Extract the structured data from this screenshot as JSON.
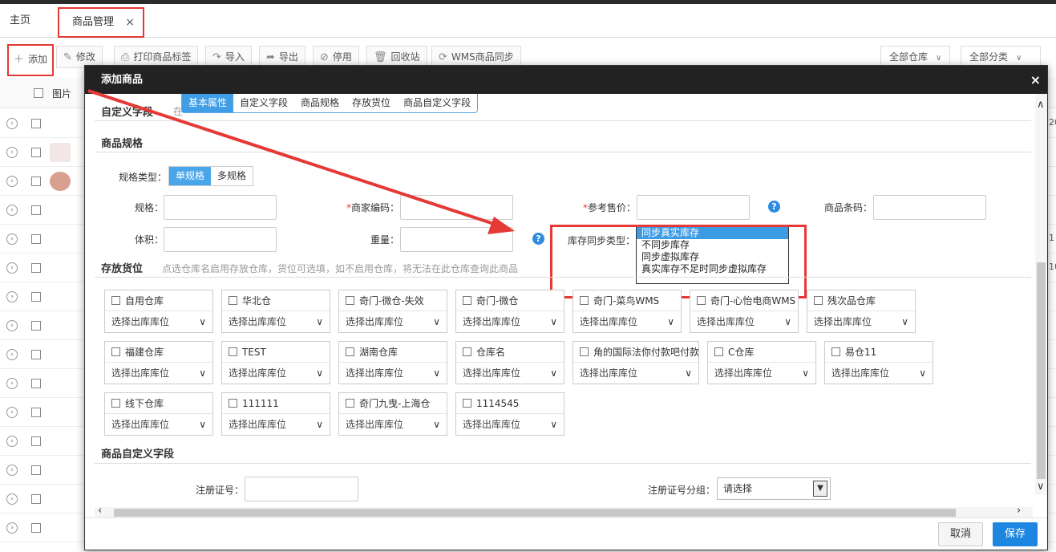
{
  "tabs": {
    "home": "主页",
    "goods": "商品管理",
    "close": "×"
  },
  "toolbar": {
    "add": "添加",
    "edit": "修改",
    "print": "打印商品标签",
    "import": "导入",
    "export": "导出",
    "disable": "停用",
    "recycle": "回收站",
    "wms_sync": "WMS商品同步",
    "warehouse_filter": "全部仓库",
    "category_filter": "全部分类"
  },
  "grid": {
    "header_image": "图片",
    "side_values": [
      "20",
      "1",
      "10"
    ]
  },
  "modal": {
    "title": "添加商品",
    "close": "×",
    "nav": [
      "基本属性",
      "自定义字段",
      "商品规格",
      "存放货位",
      "商品自定义字段"
    ],
    "custom_fields_title": "自定义字段",
    "custom_fields_hint": "在",
    "spec": {
      "title": "商品规格",
      "type_label": "规格类型：",
      "single": "单规格",
      "multi": "多规格",
      "spec_label": "规格：",
      "merchant_code_label": "商家编码：",
      "ref_price_label": "参考售价：",
      "barcode_label": "商品条码：",
      "volume_label": "体积：",
      "weight_label": "重量：",
      "stock_sync_label": "库存同步类型：",
      "stock_sync_options": [
        "同步真实库存",
        "不同步库存",
        "同步虚拟库存",
        "真实库存不足时同步虚拟库存"
      ],
      "star": "*",
      "help": "?"
    },
    "storage": {
      "title": "存放货位",
      "hint": "点选仓库名启用存放仓库，货位可选填，如不启用仓库，将无法在此仓库查询此商品",
      "select_placeholder": "选择出库库位",
      "warehouses": [
        "自用仓库",
        "华北仓",
        "奇门-微仓-失效",
        "奇门-微仓",
        "奇门-菜鸟WMS",
        "奇门-心怡电商WMS",
        "残次品仓库",
        "福建仓库",
        "TEST",
        "湖南仓库",
        "仓库名",
        "角的国际法你付款吧付款",
        "C仓库",
        "易仓11",
        "线下仓库",
        "111111",
        "奇门九曳-上海仓",
        "1114545"
      ]
    },
    "product_custom": {
      "title": "商品自定义字段",
      "reg_no_label": "注册证号：",
      "reg_group_label": "注册证号分组：",
      "reg_group_value": "请选择"
    },
    "footer": {
      "cancel": "取消",
      "save": "保存"
    }
  },
  "colors": {
    "accent": "#1c86e0",
    "highlight": "#e53935",
    "header": "#222222"
  }
}
